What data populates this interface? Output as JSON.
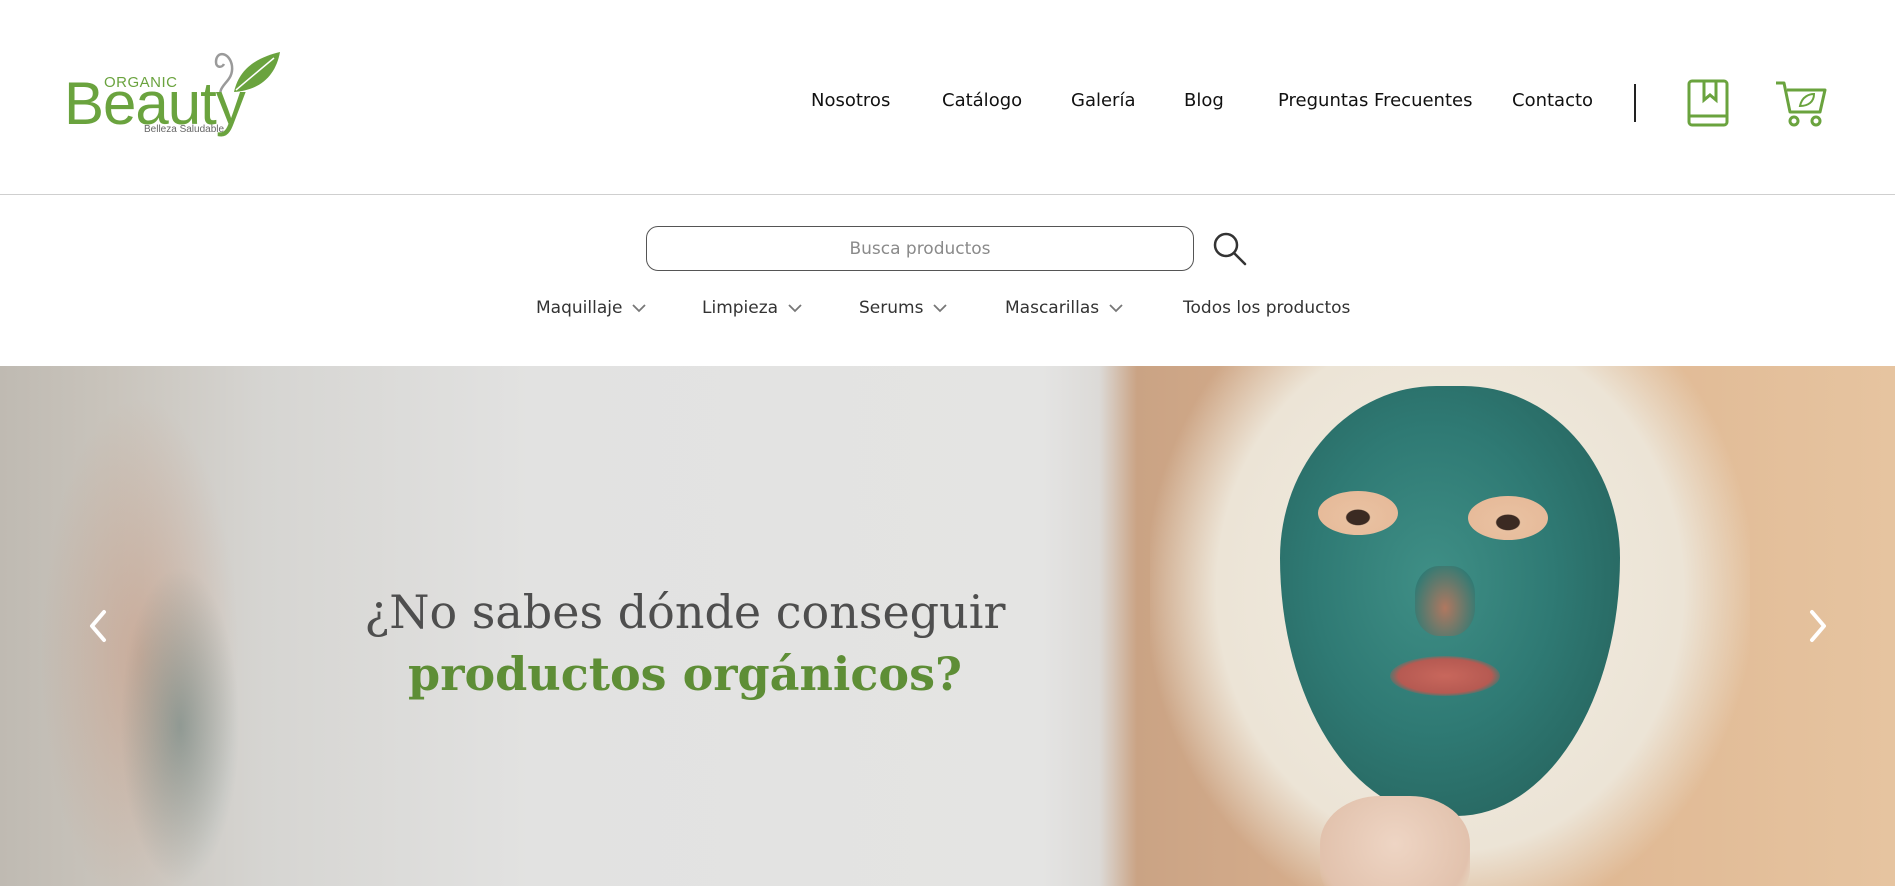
{
  "brand": {
    "logo_small": "ORGANIC",
    "logo_main": "Beauty",
    "logo_tagline": "Belleza Saludable",
    "accent_color": "#6aa33e"
  },
  "nav": {
    "items": [
      "Nosotros",
      "Catálogo",
      "Galería",
      "Blog",
      "Preguntas Frecuentes",
      "Contacto"
    ],
    "icons": [
      "book-icon",
      "cart-icon"
    ]
  },
  "search": {
    "placeholder": "Busca productos",
    "icon": "search-icon"
  },
  "categories": {
    "items": [
      {
        "label": "Maquillaje",
        "has_dropdown": true
      },
      {
        "label": "Limpieza",
        "has_dropdown": true
      },
      {
        "label": "Serums",
        "has_dropdown": true
      },
      {
        "label": "Mascarillas",
        "has_dropdown": true
      },
      {
        "label": "Todos los productos",
        "has_dropdown": false
      }
    ]
  },
  "hero": {
    "line1": "¿No sabes dónde conseguir",
    "line2": "productos orgánicos?",
    "prev_icon": "chevron-left-icon",
    "next_icon": "chevron-right-icon"
  }
}
